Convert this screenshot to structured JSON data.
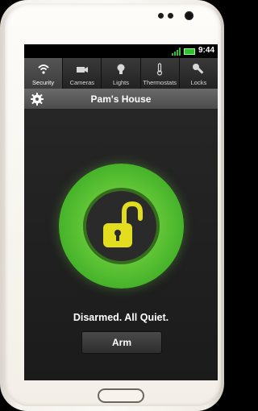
{
  "statusbar": {
    "time": "9:44"
  },
  "tabs": [
    {
      "label": "Security",
      "icon": "wifi-icon",
      "active": true
    },
    {
      "label": "Cameras",
      "icon": "camera-icon"
    },
    {
      "label": "Lights",
      "icon": "lightbulb-icon"
    },
    {
      "label": "Thermostats",
      "icon": "thermometer-icon"
    },
    {
      "label": "Locks",
      "icon": "key-icon"
    }
  ],
  "header": {
    "title": "Pam's House",
    "settings_icon": "gear-icon"
  },
  "security": {
    "status_text": "Disarmed. All Quiet.",
    "arm_label": "Arm",
    "state_icon": "unlocked-padlock-icon",
    "accent_color": "#5fc436",
    "padlock_color": "#e2dd1f"
  }
}
